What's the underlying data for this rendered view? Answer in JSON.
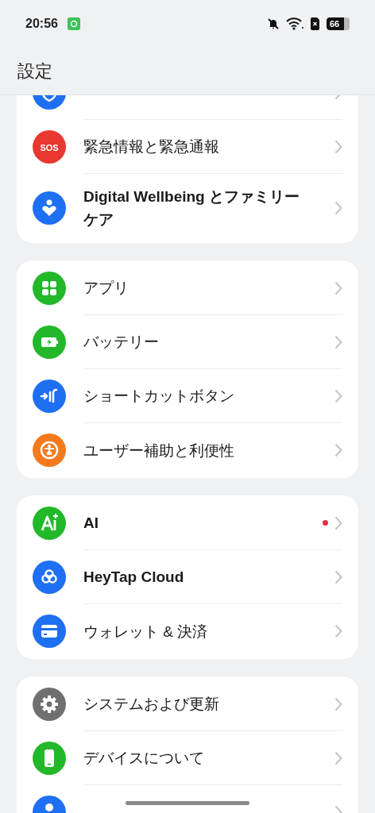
{
  "status_bar": {
    "time": "20:56",
    "battery": "66"
  },
  "title": "設定",
  "groups": [
    {
      "items": [
        {
          "kind": "shield",
          "color": "#1f6ff2"
        },
        {
          "kind": "sos",
          "icon_text": "SOS",
          "color": "#e8382f",
          "label": "緊急情報と緊急通報",
          "dot": false
        },
        {
          "kind": "wellbeing",
          "color": "#1f6ff2",
          "label": "Digital Wellbeing とファミリーケア",
          "dot": false
        }
      ]
    },
    {
      "items": [
        {
          "kind": "apps",
          "color": "#22b829",
          "label": "アプリ",
          "dot": false
        },
        {
          "kind": "battery",
          "color": "#22b829",
          "label": "バッテリー",
          "dot": false
        },
        {
          "kind": "shortcut",
          "color": "#1f6ff2",
          "label": "ショートカットボタン",
          "dot": false
        },
        {
          "kind": "accessibility",
          "color": "#f57a1c",
          "label": "ユーザー補助と利便性",
          "dot": false
        }
      ]
    },
    {
      "items": [
        {
          "kind": "ai",
          "color": "#22b829",
          "label": "AI",
          "dot": true
        },
        {
          "kind": "cloud",
          "color": "#1f6ff2",
          "label": "HeyTap Cloud",
          "dot": false
        },
        {
          "kind": "wallet",
          "color": "#1f6ff2",
          "label": "ウォレット & 決済",
          "dot": false
        }
      ]
    },
    {
      "items": [
        {
          "kind": "gear",
          "color": "#6f6f6f",
          "label": "システムおよび更新",
          "dot": false
        },
        {
          "kind": "phone",
          "color": "#22b829",
          "label": "デバイスについて",
          "dot": false
        },
        {
          "kind": "user",
          "color": "#1f6ff2"
        }
      ]
    }
  ]
}
